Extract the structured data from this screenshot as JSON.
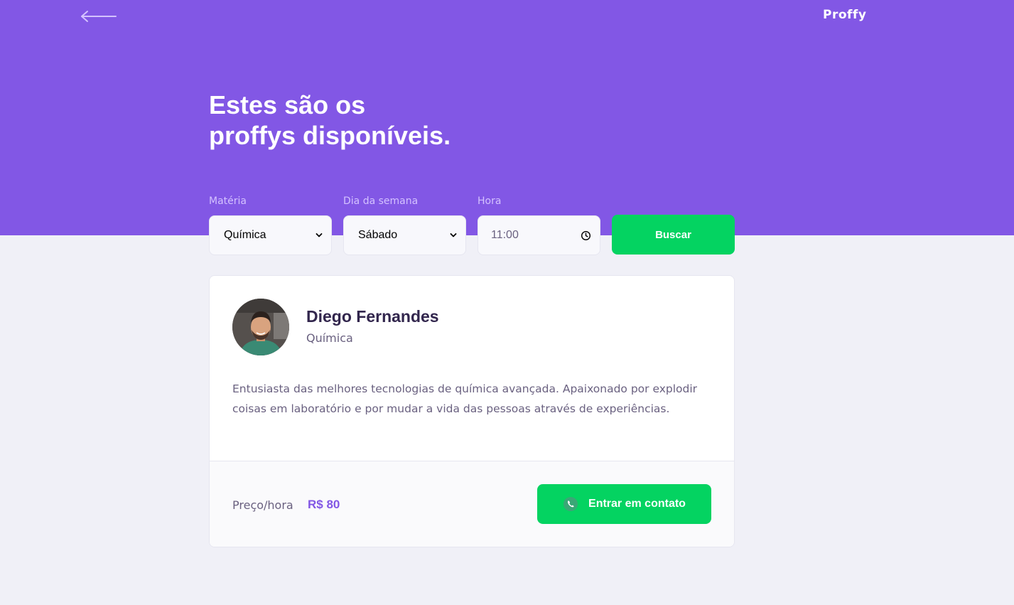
{
  "header": {
    "logo": "Proffy",
    "title_line1": "Estes são os",
    "title_line2": "proffys disponíveis."
  },
  "search": {
    "subject_label": "Matéria",
    "subject_value": "Química",
    "weekday_label": "Dia da semana",
    "weekday_value": "Sábado",
    "time_label": "Hora",
    "time_value": "11:00",
    "submit_label": "Buscar"
  },
  "teacher": {
    "name": "Diego Fernandes",
    "subject": "Química",
    "bio": "Entusiasta das melhores tecnologias de química avançada. Apaixonado por explodir coisas em laboratório e por mudar a vida das pessoas através de experiências.",
    "price_label": "Preço/hora",
    "price_value": "R$ 80",
    "contact_label": "Entrar em contato"
  },
  "colors": {
    "primary": "#8257E5",
    "secondary": "#04D361",
    "background": "#F0F0F7",
    "title_text": "#32264D",
    "body_text": "#6A6180"
  },
  "icons": {
    "back": "arrow-left-icon",
    "select": "chevron-down-icon",
    "time": "clock-icon",
    "contact": "whatsapp-icon"
  }
}
